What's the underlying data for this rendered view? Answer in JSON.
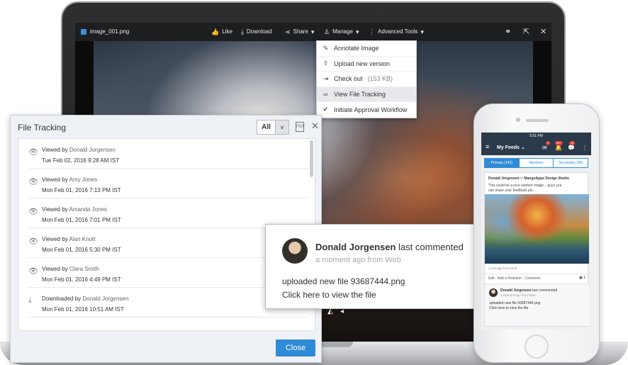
{
  "viewer": {
    "file_name": "image_001.png",
    "toolbar": {
      "like": "Like",
      "download": "Download",
      "share": "Share",
      "manage": "Manage",
      "advanced_tools": "Advanced Tools"
    },
    "menu": [
      {
        "label": "Annotate Image",
        "icon": "pencil-icon"
      },
      {
        "label": "Upload new version",
        "icon": "upload-file-icon"
      },
      {
        "label": "Check out",
        "extra": "(153 KB)",
        "icon": "checkout-icon"
      },
      {
        "label": "View File Tracking",
        "icon": "binoculars-icon"
      },
      {
        "label": "Initiate Approval Workflow",
        "icon": "check-circle-icon"
      }
    ]
  },
  "file_tracking": {
    "title": "File Tracking",
    "filter_value": "All",
    "close_label": "Close",
    "rows": [
      {
        "action": "Viewed by",
        "user": "Donald Jorgensen",
        "time": "Tue Feb 02, 2016 9:28 AM IST",
        "icon": "eye-icon"
      },
      {
        "action": "Viewed by",
        "user": "Amy Jones",
        "time": "Mon Feb 01, 2016 7:13 PM IST",
        "icon": "eye-icon"
      },
      {
        "action": "Viewed by",
        "user": "Amanda Jones",
        "time": "Mon Feb 01, 2016 7:01 PM IST",
        "icon": "eye-icon"
      },
      {
        "action": "Viewed by",
        "user": "Alan Knott",
        "time": "Mon Feb 01, 2016 5:30 PM IST",
        "icon": "eye-icon"
      },
      {
        "action": "Viewed by",
        "user": "Clara Smith",
        "time": "Mon Feb 01, 2016 4:49 PM IST",
        "icon": "eye-icon"
      },
      {
        "action": "Downloaded by",
        "user": "Donald Jorgensen",
        "time": "Mon Feb 01, 2016 10:51 AM IST",
        "icon": "download-icon"
      }
    ]
  },
  "comment_popup": {
    "name": "Donald Jorgensen",
    "suffix": "last commented",
    "subtitle": "a moment ago from Web",
    "line1": "uploaded new file 93687444.png",
    "line2": "Click here to view the file"
  },
  "phone": {
    "status_time": "5:51 PM",
    "nav_title": "My Feeds",
    "badges": [
      "2",
      "99+",
      "14"
    ],
    "tabs": [
      "Primary (142)",
      "Mentions",
      "Secondary (48)"
    ],
    "post": {
      "author": "Donald Jorgensen",
      "in": "in",
      "group": "MangoApps Design Studio",
      "text1": "This could be a nice outdoor image... guys you",
      "text2": "can share your feedback pls...",
      "time": "1 min ago from Web",
      "actions": "Edit · Add a Reaction · Comment",
      "comment_count": "1"
    },
    "comment": {
      "name": "Donald Jorgensen",
      "suffix": "last commented",
      "subtitle": "a moment ago from Web",
      "line1": "uploaded new file 93687444.png",
      "line2": "Click here to view the file"
    }
  }
}
